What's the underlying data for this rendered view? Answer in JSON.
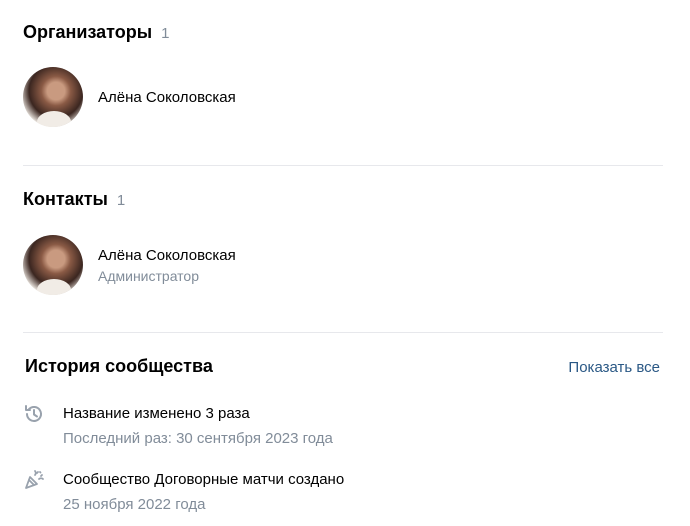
{
  "organizers": {
    "title": "Организаторы",
    "count": "1",
    "person": {
      "name": "Алёна Соколовская"
    }
  },
  "contacts": {
    "title": "Контакты",
    "count": "1",
    "person": {
      "name": "Алёна Соколовская",
      "role": "Администратор"
    }
  },
  "history": {
    "title": "История сообщества",
    "show_all": "Показать все",
    "items": [
      {
        "icon": "history-icon",
        "line1": "Название изменено 3 раза",
        "line2": "Последний раз: 30 сентября 2023 года"
      },
      {
        "icon": "party-popper-icon",
        "line1": "Сообщество Договорные матчи создано",
        "line2": "25 ноября 2022 года"
      }
    ]
  }
}
